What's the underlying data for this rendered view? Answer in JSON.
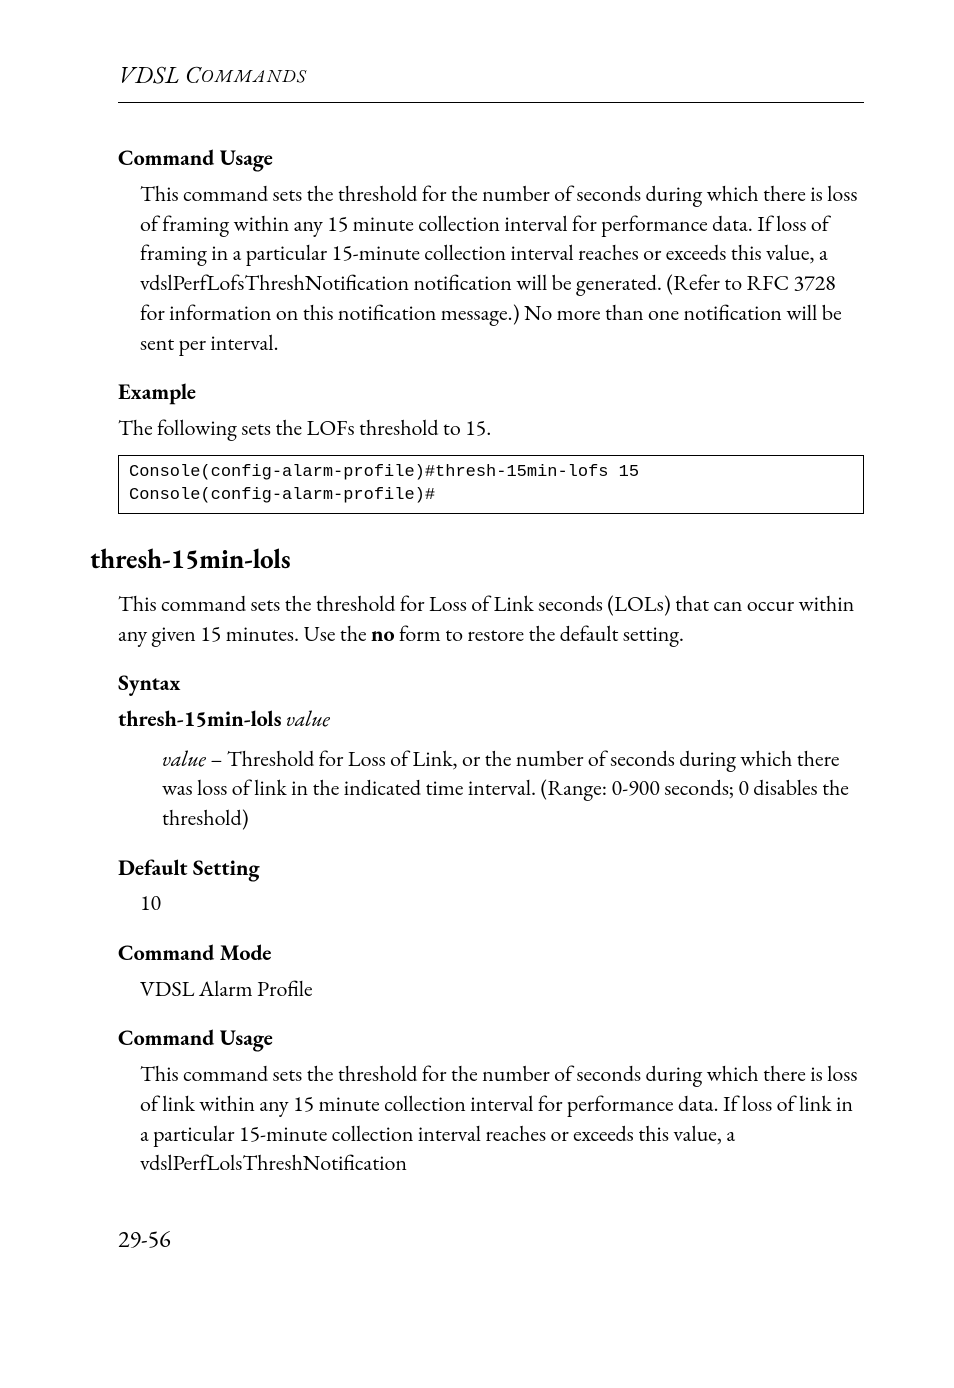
{
  "running_head_main": "VDSL C",
  "running_head_small": "OMMANDS",
  "section1": {
    "cmd_usage_h": "Command Usage",
    "cmd_usage_p": "This command sets the threshold for the number of seconds during which there is loss of framing within any 15 minute collection interval for performance data. If loss of framing in a particular 15-minute collection interval reaches or exceeds this value, a vdslPerfLofsThreshNotification notification will be generated. (Refer to RFC 3728 for information on this notification message.) No more than one notification will be sent per interval.",
    "example_h": "Example",
    "example_intro": "The following sets the LOFs threshold to 15.",
    "code": "Console(config-alarm-profile)#thresh-15min-lofs 15\nConsole(config-alarm-profile)#"
  },
  "section2": {
    "title": "thresh-15min-lols",
    "intro_pre": "This command sets the threshold for Loss of Link seconds (LOLs) that can occur within any given 15 minutes. Use the ",
    "intro_bold": "no",
    "intro_post": " form to restore the default setting.",
    "syntax_h": "Syntax",
    "syntax_cmd": "thresh-15min-lols",
    "syntax_arg": "value",
    "value_term": "value",
    "value_desc": " – Threshold for Loss of Link, or the number of seconds during which there was loss of link in the indicated time interval. (Range: 0-900 seconds; 0 disables the threshold)",
    "default_h": "Default Setting",
    "default_v": "10",
    "cmd_mode_h": "Command Mode",
    "cmd_mode_v": "VDSL Alarm Profile",
    "cmd_usage_h": "Command Usage",
    "cmd_usage_p": "This command sets the threshold for the number of seconds during which there is loss of link within any 15 minute collection interval for performance data. If loss of link in a particular 15-minute collection interval reaches or exceeds this value, a vdslPerfLolsThreshNotification"
  },
  "page_number": "29-56"
}
